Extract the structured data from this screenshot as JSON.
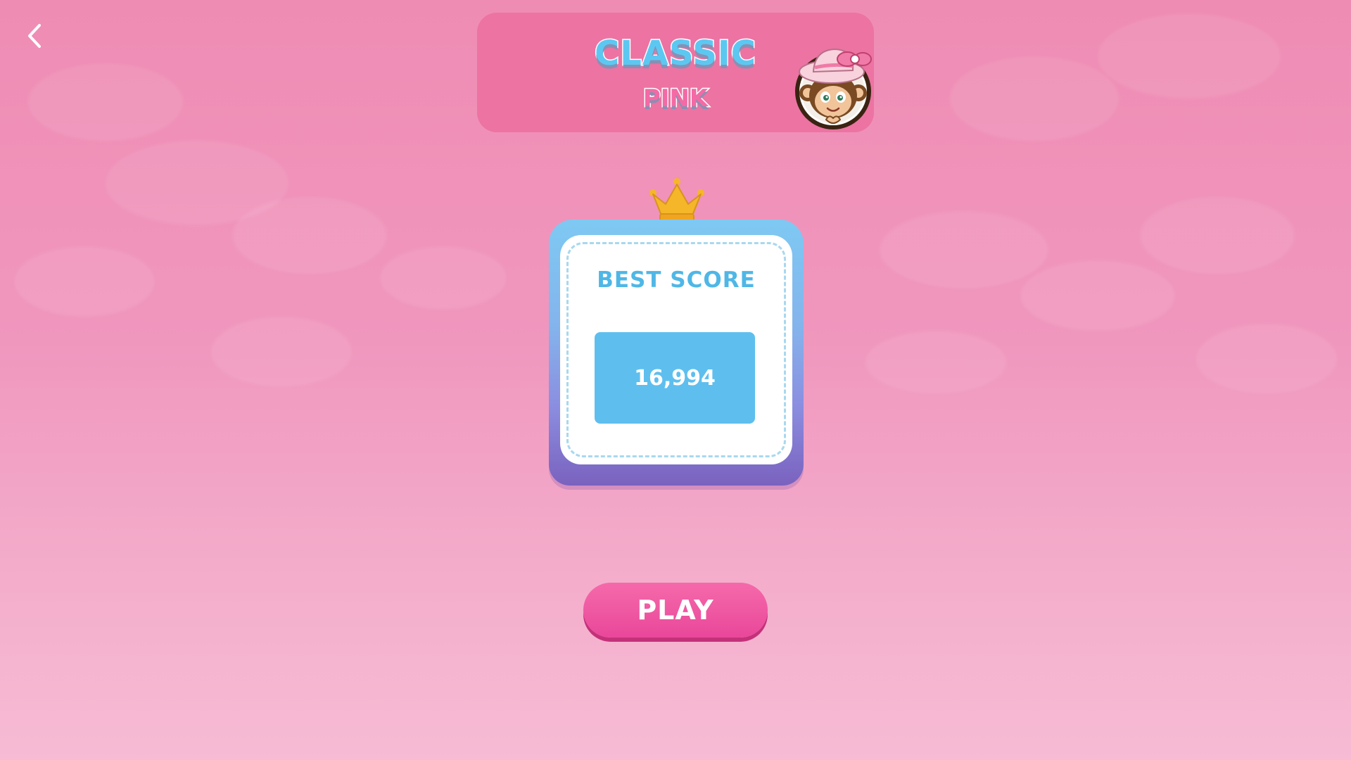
{
  "header": {
    "mode_title": "CLASSIC",
    "theme_label": "PINK"
  },
  "score_card": {
    "label": "BEST SCORE",
    "value": "16,994"
  },
  "actions": {
    "play_label": "PLAY"
  },
  "icons": {
    "back": "chevron-left-icon",
    "crown": "crown-icon",
    "mascot": "monkey-mascot-avatar"
  },
  "colors": {
    "background": "#ef8cb4",
    "header_panel": "#ec73a2",
    "title_blue": "#5cc8f2",
    "score_blue": "#5ebfee",
    "play_pink": "#ee55a0",
    "crown_gold": "#f5b62a"
  }
}
